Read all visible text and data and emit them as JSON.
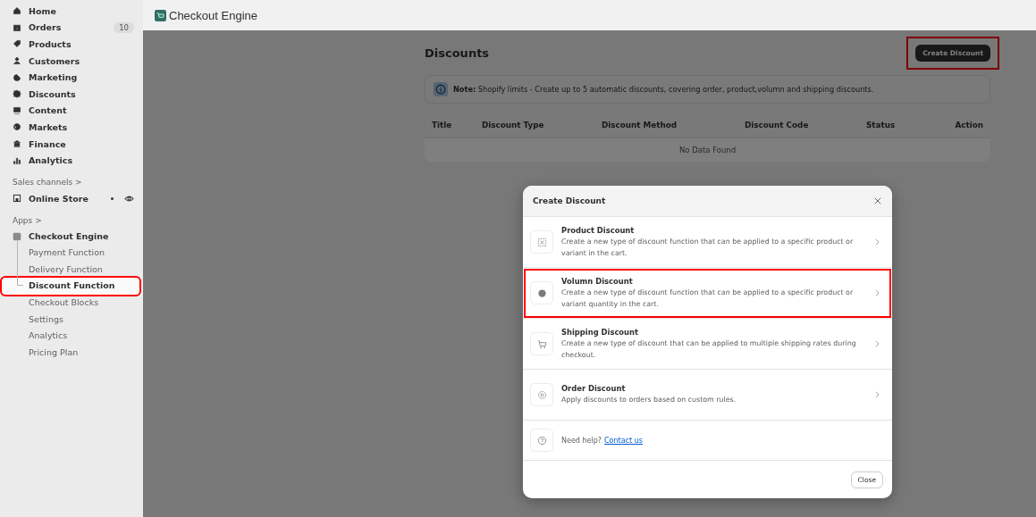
{
  "sidebar": {
    "items": [
      {
        "label": "Home"
      },
      {
        "label": "Orders",
        "badge": "10"
      },
      {
        "label": "Products"
      },
      {
        "label": "Customers"
      },
      {
        "label": "Marketing"
      },
      {
        "label": "Discounts"
      },
      {
        "label": "Content"
      },
      {
        "label": "Markets"
      },
      {
        "label": "Finance"
      },
      {
        "label": "Analytics"
      }
    ],
    "sales_channels": {
      "heading": "Sales channels >",
      "items": [
        {
          "label": "Online Store"
        }
      ]
    },
    "apps": {
      "heading": "Apps >",
      "app": {
        "label": "Checkout Engine",
        "children": [
          {
            "label": "Payment Function",
            "selected": false,
            "highlighted": false
          },
          {
            "label": "Delivery Function",
            "selected": false,
            "highlighted": false
          },
          {
            "label": "Discount Function",
            "selected": true,
            "highlighted": true
          },
          {
            "label": "Checkout Blocks",
            "selected": false,
            "highlighted": false
          },
          {
            "label": "Settings",
            "selected": false,
            "highlighted": false
          },
          {
            "label": "Analytics",
            "selected": false,
            "highlighted": false
          },
          {
            "label": "Pricing Plan",
            "selected": false,
            "highlighted": false
          }
        ]
      }
    }
  },
  "header": {
    "title": "Checkout Engine"
  },
  "page": {
    "title": "Discounts",
    "create_button": {
      "label": "Create Discount",
      "highlighted": true
    },
    "note": "**Note:** Shopify limits - Create up to 5 automatic discounts, covering order, product,volumn and shipping discounts.",
    "table": {
      "columns": [
        "Title",
        "Discount Type",
        "Discount Method",
        "Discount Code",
        "Status",
        "Action"
      ],
      "empty": "No Data Found"
    }
  },
  "modal": {
    "title": "Create Discount",
    "options": [
      {
        "title": "Product Discount",
        "description": "Create a new type of discount function that can be applied to a specific product or variant in the cart.",
        "highlighted": false
      },
      {
        "title": "Volumn Discount",
        "description": "Create a new type of discount function that can be applied to a specific product or variant quantity in the cart.",
        "highlighted": true
      },
      {
        "title": "Shipping Discount",
        "description": "Create a new type of discount that can be applied to multiple shipping rates during checkout.",
        "highlighted": false
      },
      {
        "title": "Order Discount",
        "description": "Apply discounts to orders based on custom rules.",
        "highlighted": false
      }
    ],
    "help": {
      "text": "Need help?",
      "link": "Contact us"
    },
    "close_button": "Close"
  }
}
